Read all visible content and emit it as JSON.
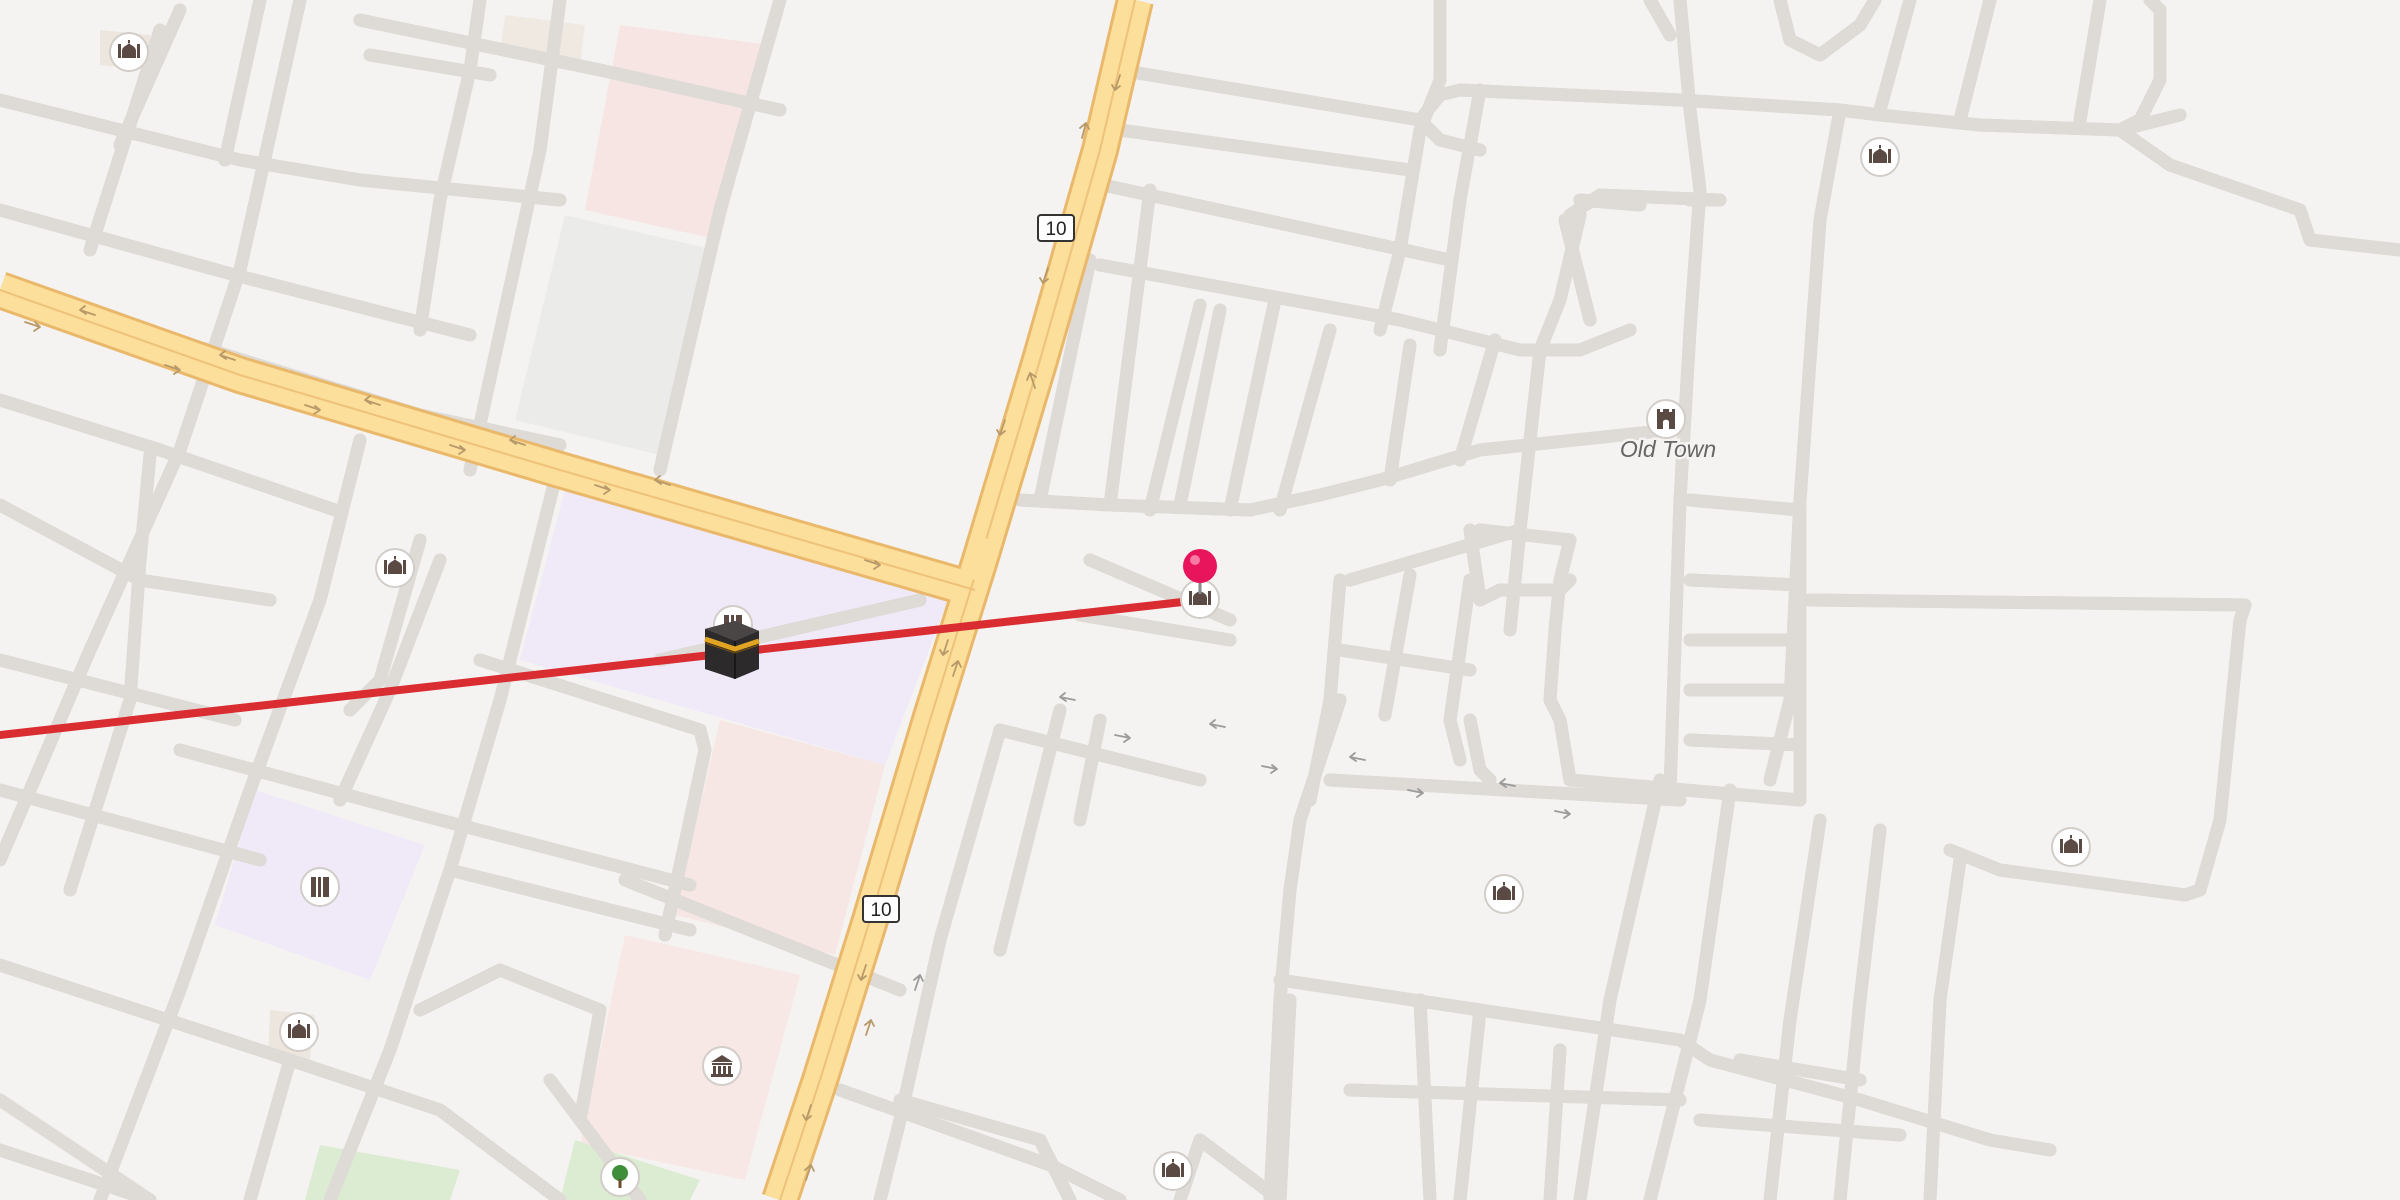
{
  "map": {
    "place_labels": [
      {
        "id": "old-town",
        "text": "Old Town"
      }
    ],
    "route_shields": [
      {
        "id": "shield-upper",
        "text": "10"
      },
      {
        "id": "shield-lower",
        "text": "10"
      }
    ],
    "route_line_color": "#d92d32",
    "pin_color": "#e8155c",
    "highway_color": "#fbdf9a",
    "poi_icons": [
      "mosque-icon",
      "mosque-icon",
      "mosque-icon",
      "mosque-icon",
      "mosque-icon",
      "mosque-icon",
      "mosque-icon",
      "mosque-icon",
      "museum-icon",
      "museum-icon",
      "government-building-icon",
      "park-tree-icon",
      "castle-icon",
      "kaaba-icon",
      "location-pin-icon"
    ]
  }
}
